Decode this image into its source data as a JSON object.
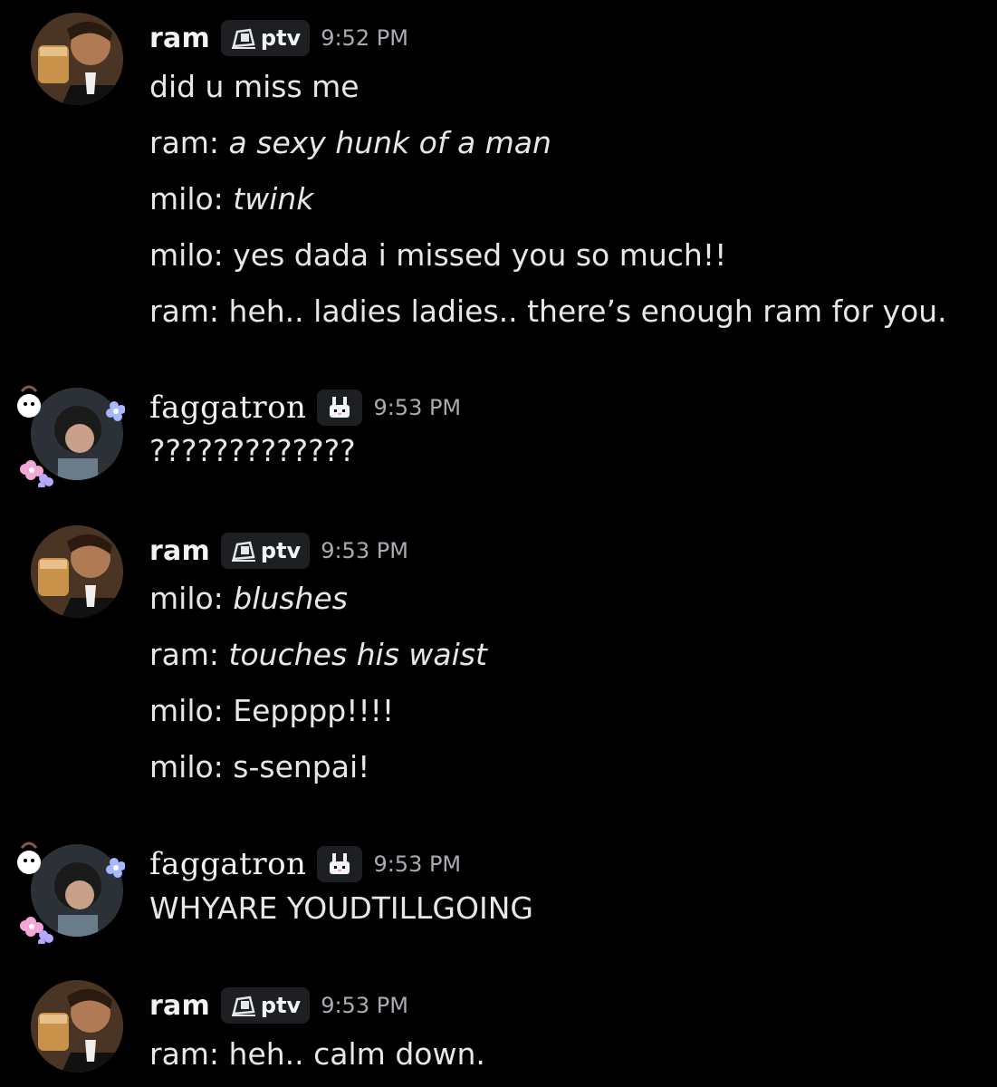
{
  "messages": [
    {
      "user": "ram",
      "tag": "ptv",
      "time": "9:52 PM",
      "lines": [
        {
          "prefix": "did u miss me",
          "italic": ""
        },
        {
          "prefix": "ram: ",
          "italic": "a sexy hunk of a man"
        },
        {
          "prefix": "milo: ",
          "italic": "twink"
        },
        {
          "prefix": "milo: yes dada i missed you so much!!",
          "italic": ""
        },
        {
          "prefix": "ram: heh.. ladies ladies.. there’s enough ram for you.",
          "italic": ""
        }
      ]
    },
    {
      "user": "faggatron",
      "tag": "bunny",
      "time": "9:53 PM",
      "lines": [
        {
          "prefix": "?????????????",
          "italic": ""
        }
      ]
    },
    {
      "user": "ram",
      "tag": "ptv",
      "time": "9:53 PM",
      "lines": [
        {
          "prefix": "milo: ",
          "italic": "blushes"
        },
        {
          "prefix": "ram: ",
          "italic": "touches his waist"
        },
        {
          "prefix": "milo: Eepppp!!!!",
          "italic": ""
        },
        {
          "prefix": "milo: s-senpai!",
          "italic": ""
        }
      ]
    },
    {
      "user": "faggatron",
      "tag": "bunny",
      "time": "9:53 PM",
      "lines": [
        {
          "prefix": "WHYARE YOUDTILLGOING",
          "italic": ""
        }
      ]
    },
    {
      "user": "ram",
      "tag": "ptv",
      "time": "9:53 PM",
      "lines": [
        {
          "prefix": "ram: heh.. calm down.",
          "italic": ""
        }
      ]
    }
  ],
  "icons": {
    "ram_avatar": "avatar-man-holding-glass",
    "faggatron_avatar": "avatar-headphones-with-flowers",
    "ptv_tag_icon": "camera-icon",
    "bunny_tag_icon": "bunny-icon"
  },
  "colors": {
    "background": "#000000",
    "username": "#f2f3f5",
    "message_text": "#e6e7ea",
    "timestamp": "#a9acb3",
    "tag_background": "#1e1f22"
  }
}
